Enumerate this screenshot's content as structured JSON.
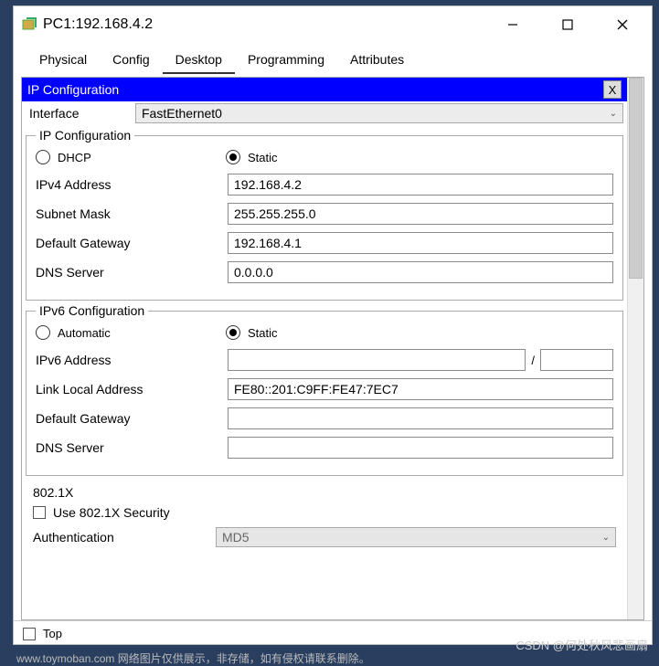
{
  "window": {
    "title": "PC1:192.168.4.2"
  },
  "tabs": {
    "physical": "Physical",
    "config": "Config",
    "desktop": "Desktop",
    "programming": "Programming",
    "attributes": "Attributes"
  },
  "panel": {
    "title": "IP Configuration",
    "close": "X",
    "interface_label": "Interface",
    "interface_value": "FastEthernet0"
  },
  "ipv4": {
    "legend": "IP Configuration",
    "dhcp": "DHCP",
    "static": "Static",
    "addr_label": "IPv4 Address",
    "addr_value": "192.168.4.2",
    "mask_label": "Subnet Mask",
    "mask_value": "255.255.255.0",
    "gw_label": "Default Gateway",
    "gw_value": "192.168.4.1",
    "dns_label": "DNS Server",
    "dns_value": "0.0.0.0"
  },
  "ipv6": {
    "legend": "IPv6 Configuration",
    "auto": "Automatic",
    "static": "Static",
    "addr_label": "IPv6 Address",
    "addr_value": "",
    "prefix_value": "",
    "lla_label": "Link Local Address",
    "lla_value": "FE80::201:C9FF:FE47:7EC7",
    "gw_label": "Default Gateway",
    "gw_value": "",
    "dns_label": "DNS Server",
    "dns_value": ""
  },
  "dot1x": {
    "title": "802.1X",
    "use_label": "Use 802.1X Security",
    "auth_label": "Authentication",
    "auth_value": "MD5"
  },
  "footer": {
    "top": "Top"
  },
  "watermark": {
    "line": "www.toymoban.com  网络图片仅供展示，非存储，如有侵权请联系删除。",
    "csdn": "CSDN @何处秋风悲画扇"
  }
}
